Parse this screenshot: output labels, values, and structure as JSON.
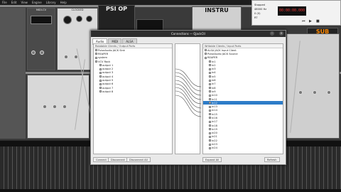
{
  "menubar": {
    "items": [
      "File",
      "Edit",
      "View",
      "Engine",
      "Library",
      "Help"
    ]
  },
  "rack": {
    "module_titles": [
      "MIDI-CV",
      "CLOCKED",
      "PSI OP",
      "INSTRU",
      "SUB"
    ]
  },
  "dialog": {
    "title": "Connections — QjackCtl",
    "tabs": [
      "Audio",
      "MIDI",
      "ALSA"
    ],
    "active_tab": "Audio",
    "left_header": "Readable Clients / Output Ports",
    "right_header": "Writable Clients / Input Ports",
    "left_items": [
      {
        "label": "PulseAudio JACK Sink",
        "level": 0,
        "selected": false
      },
      {
        "label": "REAPER",
        "level": 0,
        "selected": false
      },
      {
        "label": "system",
        "level": 0,
        "selected": false
      },
      {
        "label": "VCV Rack",
        "level": 0,
        "selected": false
      },
      {
        "label": "output 1",
        "level": 1,
        "selected": false
      },
      {
        "label": "output 2",
        "level": 1,
        "selected": false
      },
      {
        "label": "output 3",
        "level": 1,
        "selected": false
      },
      {
        "label": "output 4",
        "level": 1,
        "selected": false
      },
      {
        "label": "output 5",
        "level": 1,
        "selected": false
      },
      {
        "label": "output 6",
        "level": 1,
        "selected": false
      },
      {
        "label": "output 7",
        "level": 1,
        "selected": false
      },
      {
        "label": "output 8",
        "level": 1,
        "selected": false
      }
    ],
    "right_items": [
      {
        "label": "ALSA JACK Input Client",
        "level": 0,
        "selected": false
      },
      {
        "label": "PulseAudio JACK Source",
        "level": 0,
        "selected": false
      },
      {
        "label": "REAPER",
        "level": 0,
        "selected": false
      },
      {
        "label": "in1",
        "level": 1,
        "selected": false
      },
      {
        "label": "in2",
        "level": 1,
        "selected": false
      },
      {
        "label": "in3",
        "level": 1,
        "selected": false
      },
      {
        "label": "in4",
        "level": 1,
        "selected": false
      },
      {
        "label": "in5",
        "level": 1,
        "selected": false
      },
      {
        "label": "in6",
        "level": 1,
        "selected": false
      },
      {
        "label": "in7",
        "level": 1,
        "selected": false
      },
      {
        "label": "in8",
        "level": 1,
        "selected": false
      },
      {
        "label": "in9",
        "level": 1,
        "selected": false
      },
      {
        "label": "in10",
        "level": 1,
        "selected": false
      },
      {
        "label": "in11",
        "level": 1,
        "selected": false
      },
      {
        "label": "in12",
        "level": 1,
        "selected": true
      },
      {
        "label": "in13",
        "level": 1,
        "selected": false
      },
      {
        "label": "in14",
        "level": 1,
        "selected": false
      },
      {
        "label": "in15",
        "level": 1,
        "selected": false
      },
      {
        "label": "in16",
        "level": 1,
        "selected": false
      },
      {
        "label": "in17",
        "level": 1,
        "selected": false
      },
      {
        "label": "in18",
        "level": 1,
        "selected": false
      },
      {
        "label": "in19",
        "level": 1,
        "selected": false
      },
      {
        "label": "in20",
        "level": 1,
        "selected": false
      },
      {
        "label": "in21",
        "level": 1,
        "selected": false
      },
      {
        "label": "in22",
        "level": 1,
        "selected": false
      },
      {
        "label": "in23",
        "level": 1,
        "selected": false
      },
      {
        "label": "in24",
        "level": 1,
        "selected": false
      }
    ],
    "buttons": {
      "connect": "Connect",
      "disconnect": "Disconnect",
      "disconnect_all": "Disconnect All",
      "expand_all": "Expand All",
      "refresh": "Refresh"
    }
  },
  "transport": {
    "time": "00:00:00.000",
    "status_rows": [
      "Stopped",
      "48000 Hz",
      "0 (0)",
      "RT"
    ]
  },
  "colors": {
    "selection": "#2d7cc8",
    "clock_text": "#e33"
  }
}
